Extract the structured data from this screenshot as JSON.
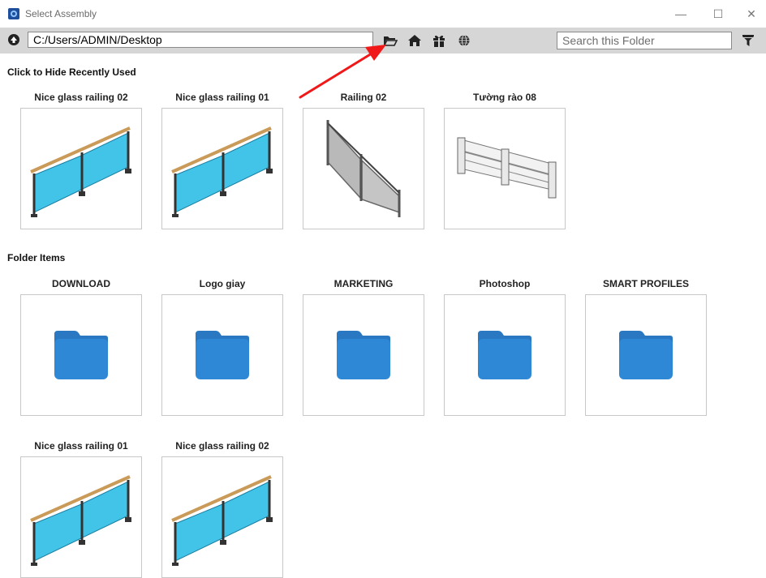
{
  "window": {
    "title": "Select Assembly",
    "minimize_glyph": "—",
    "maximize_glyph": "☐",
    "close_glyph": "✕"
  },
  "toolbar": {
    "path_value": "C:/Users/ADMIN/Desktop",
    "search_placeholder": "Search this Folder",
    "icons": [
      "up-icon",
      "open-folder-icon",
      "home-icon",
      "gift-icon",
      "globe-icon",
      "filter-icon"
    ]
  },
  "recent": {
    "header": "Click to Hide Recently Used",
    "items": [
      {
        "label": "Nice glass railing 02",
        "kind": "glass-railing"
      },
      {
        "label": "Nice glass railing 01",
        "kind": "glass-railing"
      },
      {
        "label": "Railing 02",
        "kind": "grey-railing"
      },
      {
        "label": "Tường rào 08",
        "kind": "fence"
      }
    ]
  },
  "folder": {
    "header": "Folder Items",
    "items": [
      {
        "label": "DOWNLOAD",
        "kind": "folder"
      },
      {
        "label": "Logo giay",
        "kind": "folder"
      },
      {
        "label": "MARKETING",
        "kind": "folder"
      },
      {
        "label": "Photoshop",
        "kind": "folder"
      },
      {
        "label": "SMART PROFILES",
        "kind": "folder"
      },
      {
        "label": "Nice glass railing 01",
        "kind": "glass-railing"
      },
      {
        "label": "Nice glass railing 02",
        "kind": "glass-railing"
      }
    ]
  },
  "colors": {
    "toolbar_bg": "#d6d6d6",
    "folder_blue": "#2f88d6",
    "glass_blue": "#41c4e8",
    "arrow_red": "#f01818"
  }
}
